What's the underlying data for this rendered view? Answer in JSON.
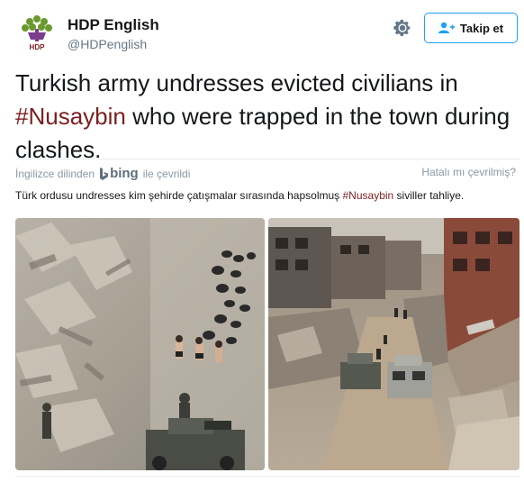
{
  "account": {
    "name": "HDP English",
    "handle": "@HDPenglish",
    "logo_text": "HDP",
    "logo_colors": {
      "tree": "#6a9a2e",
      "crown": "#7b3d8c",
      "text": "#7a1f1f"
    }
  },
  "header": {
    "settings_icon": "gear-icon",
    "follow_label": "Takip et",
    "follow_icon": "add-user-icon"
  },
  "tweet": {
    "text_before": "Turkish army undresses evicted civilians in ",
    "hashtag": "#Nusaybin",
    "text_after": " who were trapped in the town during clashes."
  },
  "translation_bar": {
    "left_prefix": "İngilizce dilinden",
    "brand": "bing",
    "left_suffix": "ile çevrildi",
    "right": "Hatalı mı çevrilmiş?"
  },
  "translation": {
    "text_before": "Türk ordusu undresses kim şehirde çatışmalar sırasında hapsolmuş ",
    "hashtag": "#Nusaybin",
    "text_after": " siviller tahliye."
  },
  "media": [
    {
      "name": "left-photo",
      "subject": "rubble-with-kneeling-civilians-and-armored-vehicle"
    },
    {
      "name": "right-photo",
      "subject": "destroyed-street-with-armored-vehicles"
    }
  ],
  "colors": {
    "accent": "#1da1f2",
    "hashtag": "#7a1f1f",
    "muted": "#8899a6"
  }
}
